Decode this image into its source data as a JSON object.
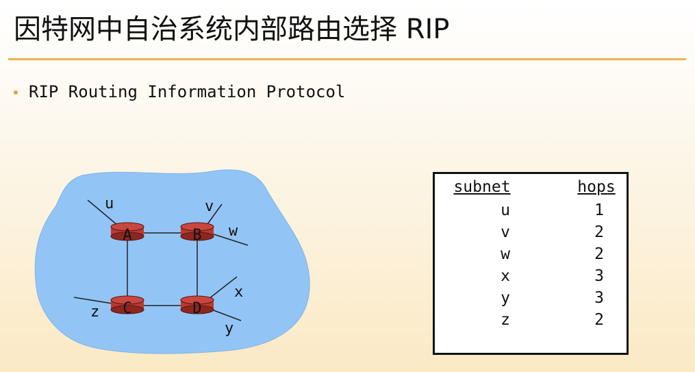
{
  "slide": {
    "title": "因特网中自治系统内部路由选择  RIP",
    "bullet": "RIP Routing Information Protocol"
  },
  "diagram": {
    "routers": [
      "A",
      "B",
      "C",
      "D"
    ],
    "subnets": [
      "u",
      "v",
      "w",
      "x",
      "y",
      "z"
    ]
  },
  "table": {
    "headers": {
      "subnet": "subnet",
      "hops": "hops"
    },
    "rows": [
      {
        "subnet": "u",
        "hops": "1"
      },
      {
        "subnet": "v",
        "hops": "2"
      },
      {
        "subnet": "w",
        "hops": "2"
      },
      {
        "subnet": "x",
        "hops": "3"
      },
      {
        "subnet": "y",
        "hops": "3"
      },
      {
        "subnet": "z",
        "hops": "2"
      }
    ]
  },
  "colors": {
    "accent": "#f0b04a",
    "cloud": "#92c5f6",
    "router": "#b83a32",
    "router_dark": "#7a1f1a"
  }
}
